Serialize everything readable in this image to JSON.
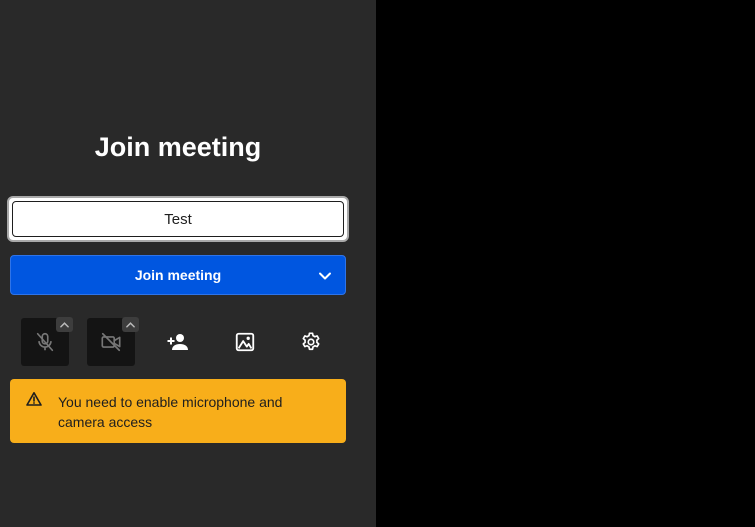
{
  "prejoin": {
    "title": "Join meeting",
    "name_input": {
      "value": "Test",
      "placeholder": ""
    },
    "join_button": {
      "label": "Join meeting"
    },
    "toolbar": [
      {
        "icon": "microphone-muted-icon",
        "active": false
      },
      {
        "icon": "camera-off-icon",
        "active": false
      },
      {
        "icon": "invite-people-icon"
      },
      {
        "icon": "virtual-background-icon"
      },
      {
        "icon": "settings-icon"
      }
    ],
    "warning": {
      "icon": "warning-triangle-icon",
      "text": "You need to enable microphone and camera access"
    }
  },
  "colors": {
    "panel_bg": "#292929",
    "stage_bg": "#000000",
    "primary": "#0056e0",
    "warning": "#f8ae1a",
    "toolbar_dark": "#141414"
  }
}
